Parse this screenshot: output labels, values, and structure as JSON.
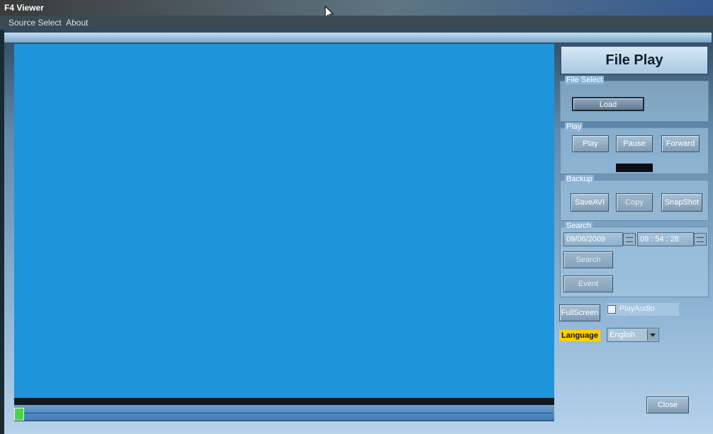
{
  "window": {
    "title": "F4 Viewer"
  },
  "menu": {
    "items": [
      "Source Select",
      "About"
    ]
  },
  "panel": {
    "title": "File Play",
    "file_select": {
      "label": "File Select",
      "load": "Load"
    },
    "play": {
      "label": "Play",
      "play": "Play",
      "pause": "Pause",
      "forward": "Forward"
    },
    "backup": {
      "label": "Backup",
      "saveavi": "SaveAVI",
      "copy": "Copy",
      "snapshot": "SnapShot"
    },
    "search": {
      "label": "Search",
      "date": "09/06/2009",
      "time": "09 : 54 : 28",
      "search": "Search",
      "event": "Event"
    },
    "fullscreen": "FullScreen",
    "play_audio": {
      "label": "PlayAudio",
      "checked": false
    },
    "language": {
      "label": "Language",
      "selected": "English"
    },
    "close": "Close"
  },
  "colors": {
    "video_bg": "#1e94da",
    "language_highlight": "#ffd000",
    "slider_thumb": "#4ad24a"
  },
  "icons": [
    "mouse-pointer-icon",
    "spinner-icon",
    "dropdown-arrow-icon"
  ]
}
